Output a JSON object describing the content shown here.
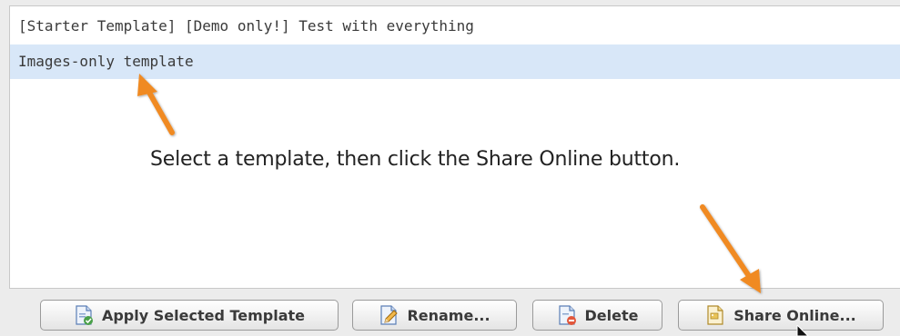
{
  "templates": [
    {
      "label": "[Starter Template] [Demo only!] Test with everything",
      "selected": false
    },
    {
      "label": "Images-only template",
      "selected": true
    }
  ],
  "annotation": {
    "caption": "Select a template, then click the Share Online button.",
    "arrow_color": "#f08a24"
  },
  "buttons": {
    "apply": {
      "label": "Apply Selected Template",
      "icon": "apply-template-icon"
    },
    "rename": {
      "label": "Rename...",
      "icon": "rename-pencil-icon"
    },
    "delete": {
      "label": "Delete",
      "icon": "delete-document-icon"
    },
    "share": {
      "label": "Share Online...",
      "icon": "share-online-icon"
    }
  },
  "colors": {
    "selection": "#d8e7f8",
    "panel_bg": "#ffffff",
    "window_bg": "#ececec"
  }
}
